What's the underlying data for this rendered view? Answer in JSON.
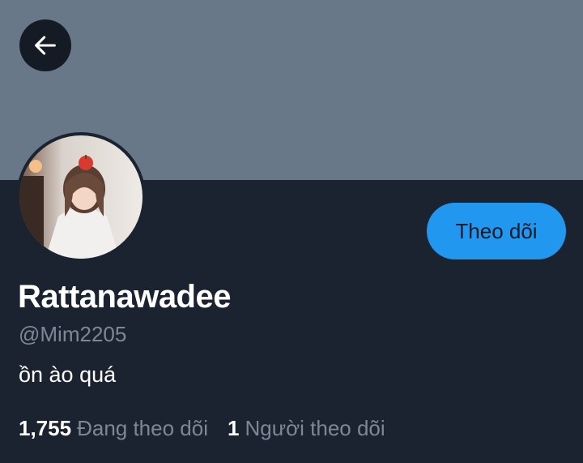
{
  "header": {
    "back_icon": "arrow-left-icon",
    "banner_color": "#687888"
  },
  "profile": {
    "avatar_icon": "profile-photo",
    "display_name": "Rattanawadee",
    "handle": "@Mim2205",
    "bio": "ồn ào quá",
    "follow_label": "Theo dõi"
  },
  "stats": {
    "following_count": "1,755",
    "following_label": "Đang theo dõi",
    "followers_count": "1",
    "followers_label": "Người theo dõi"
  },
  "colors": {
    "background": "#1b2330",
    "accent": "#2197f0",
    "secondary_text": "#7c8896"
  }
}
